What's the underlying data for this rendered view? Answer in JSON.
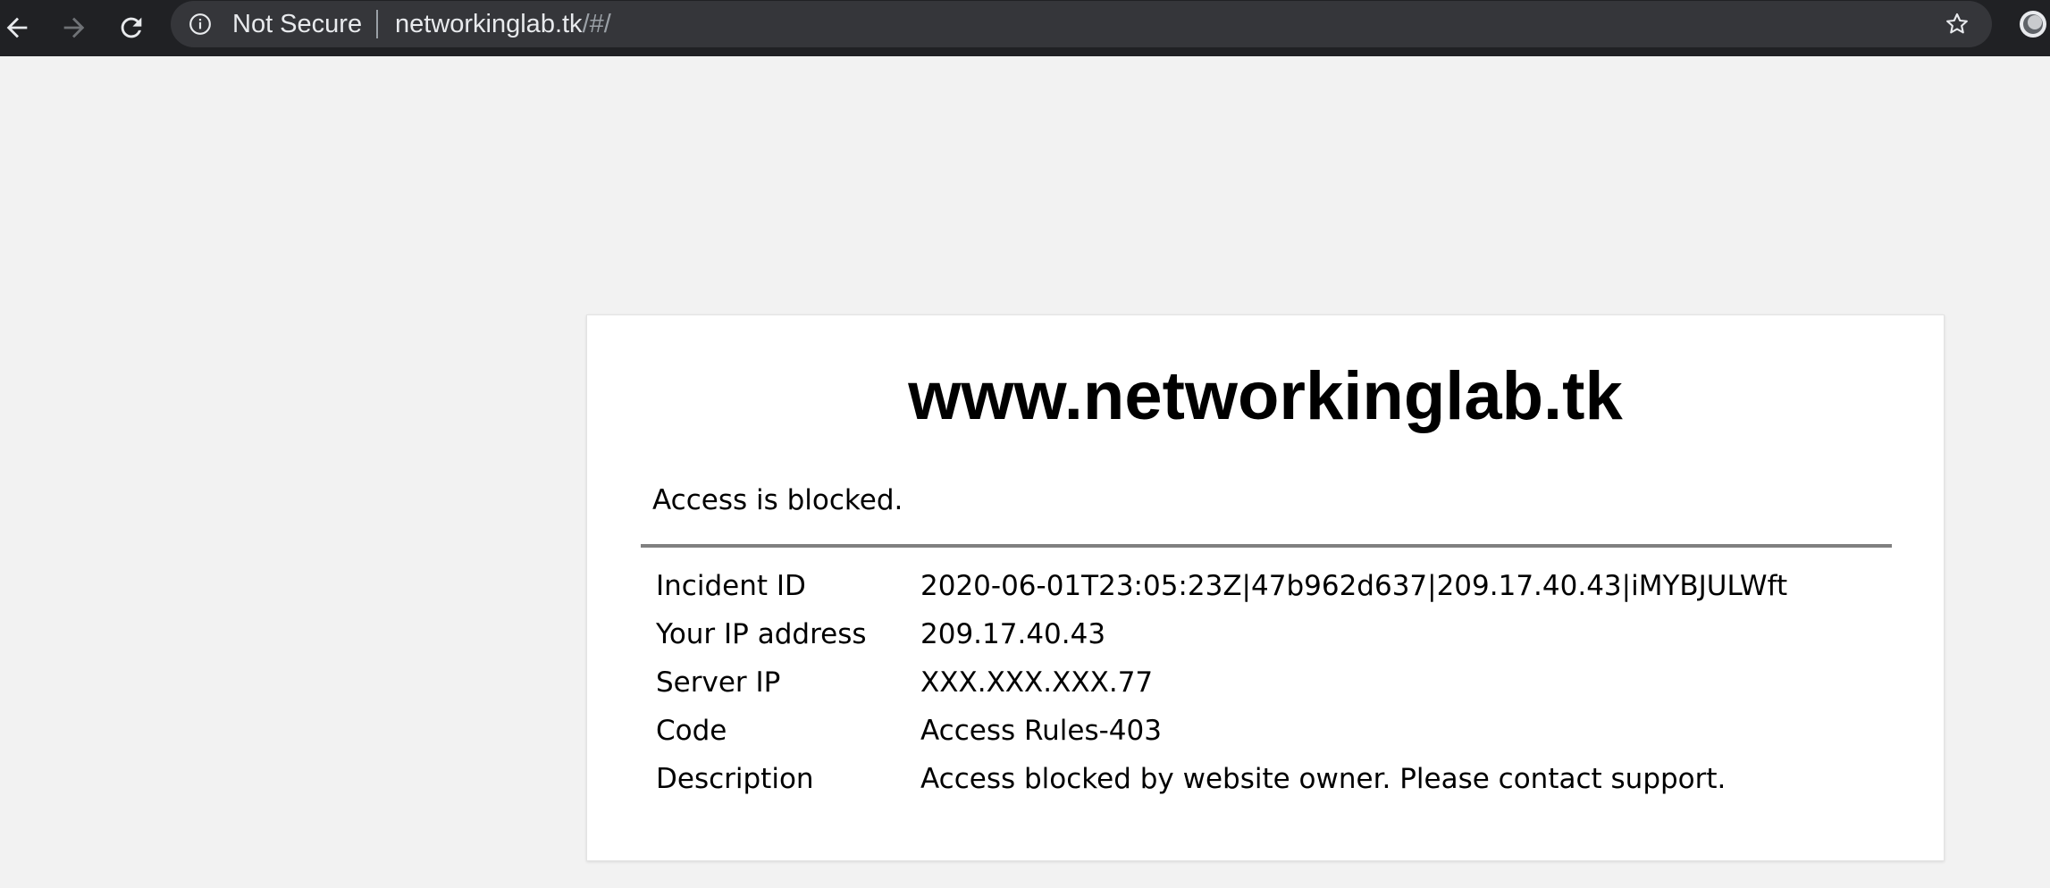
{
  "browser": {
    "security_label": "Not Secure",
    "url_host": "networkinglab.tk",
    "url_path": "/#/",
    "icons": {
      "back": "arrow-left-icon",
      "forward": "arrow-right-icon",
      "reload": "reload-icon",
      "info": "info-icon",
      "bookmark": "star-icon",
      "extension": "extension-icon"
    }
  },
  "page": {
    "title": "www.networkinglab.tk",
    "message": "Access is blocked.",
    "details": [
      {
        "label": "Incident ID",
        "value": "2020-06-01T23:05:23Z|47b962d637|209.17.40.43|iMYBJULWft"
      },
      {
        "label": "Your IP address",
        "value": "209.17.40.43"
      },
      {
        "label": "Server IP",
        "value": "XXX.XXX.XXX.77"
      },
      {
        "label": "Code",
        "value": "Access Rules-403"
      },
      {
        "label": "Description",
        "value": "Access blocked by website owner. Please contact support."
      }
    ]
  },
  "colors": {
    "toolbar_bg": "#202124",
    "omnibox_bg": "#35363a",
    "page_bg": "#f2f2f2",
    "card_bg": "#ffffff",
    "divider": "#808080"
  }
}
